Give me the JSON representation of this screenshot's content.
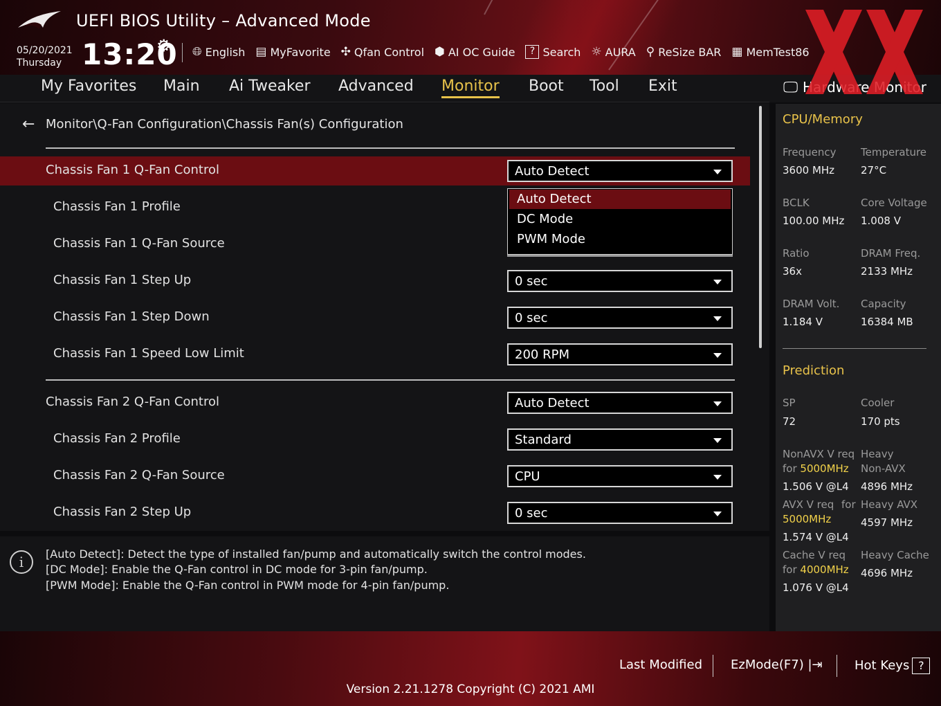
{
  "header": {
    "title": "UEFI BIOS Utility – Advanced Mode",
    "date": "05/20/2021",
    "day": "Thursday",
    "time": "13:20",
    "toolbar": [
      {
        "label": "English",
        "icon": "globe-icon"
      },
      {
        "label": "MyFavorite",
        "icon": "favorite-list-icon"
      },
      {
        "label": "Qfan Control",
        "icon": "fan-icon"
      },
      {
        "label": "AI OC Guide",
        "icon": "ai-chip-icon"
      },
      {
        "label": "Search",
        "icon": "search-help-icon"
      },
      {
        "label": "AURA",
        "icon": "aura-light-icon"
      },
      {
        "label": "ReSize BAR",
        "icon": "resize-bar-icon"
      },
      {
        "label": "MemTest86",
        "icon": "memory-icon"
      }
    ]
  },
  "menu": {
    "items": [
      "My Favorites",
      "Main",
      "Ai Tweaker",
      "Advanced",
      "Monitor",
      "Boot",
      "Tool",
      "Exit"
    ],
    "active": "Monitor"
  },
  "breadcrumb": "Monitor\\Q-Fan Configuration\\Chassis Fan(s) Configuration",
  "settings": [
    {
      "label": "Chassis Fan 1 Q-Fan Control",
      "value": "Auto Detect"
    },
    {
      "label": "Chassis Fan 1 Profile",
      "value": ""
    },
    {
      "label": "Chassis Fan 1 Q-Fan Source",
      "value": ""
    },
    {
      "label": "Chassis Fan 1 Step Up",
      "value": "0 sec"
    },
    {
      "label": "Chassis Fan 1 Step Down",
      "value": "0 sec"
    },
    {
      "label": "Chassis Fan 1 Speed Low Limit",
      "value": "200 RPM"
    },
    {
      "label": "Chassis Fan 2 Q-Fan Control",
      "value": "Auto Detect"
    },
    {
      "label": "Chassis Fan 2 Profile",
      "value": "Standard"
    },
    {
      "label": "Chassis Fan 2 Q-Fan Source",
      "value": "CPU"
    },
    {
      "label": "Chassis Fan 2 Step Up",
      "value": "0 sec"
    }
  ],
  "dropdown": {
    "options": [
      "Auto Detect",
      "DC Mode",
      "PWM Mode"
    ],
    "selected": "Auto Detect"
  },
  "help": {
    "lines": [
      "[Auto Detect]: Detect the type of installed fan/pump and automatically switch the control modes.",
      "[DC Mode]: Enable the Q-Fan control in DC mode for 3-pin fan/pump.",
      "[PWM Mode]: Enable the Q-Fan control in PWM mode for 4-pin fan/pump."
    ]
  },
  "hardware_monitor": {
    "title": "Hardware Monitor",
    "cpu_memory": {
      "title": "CPU/Memory",
      "frequency_label": "Frequency",
      "frequency": "3600 MHz",
      "temperature_label": "Temperature",
      "temperature": "27°C",
      "bclk_label": "BCLK",
      "bclk": "100.00 MHz",
      "core_voltage_label": "Core Voltage",
      "core_voltage": "1.008 V",
      "ratio_label": "Ratio",
      "ratio": "36x",
      "dram_freq_label": "DRAM Freq.",
      "dram_freq": "2133 MHz",
      "dram_volt_label": "DRAM Volt.",
      "dram_volt": "1.184 V",
      "capacity_label": "Capacity",
      "capacity": "16384 MB"
    },
    "prediction": {
      "title": "Prediction",
      "sp_label": "SP",
      "sp": "72",
      "cooler_label": "Cooler",
      "cooler": "170 pts",
      "nonavx_req_label": "NonAVX V req",
      "nonavx_for": "for",
      "nonavx_freq": "5000MHz",
      "nonavx_volt": "1.506 V @L4",
      "heavy_nonavx_label1": "Heavy",
      "heavy_nonavx_label2": "Non-AVX",
      "heavy_nonavx": "4896 MHz",
      "avx_req_label": "AVX V req",
      "avx_for": "for",
      "avx_freq": "5000MHz",
      "avx_volt": "1.574 V @L4",
      "heavy_avx_label": "Heavy AVX",
      "heavy_avx": "4597 MHz",
      "cache_req_label": "Cache V req",
      "cache_for": "for",
      "cache_freq": "4000MHz",
      "cache_volt": "1.076 V @L4",
      "heavy_cache_label": "Heavy Cache",
      "heavy_cache": "4696 MHz"
    }
  },
  "footer": {
    "last_modified": "Last Modified",
    "ezmode": "EzMode(F7)",
    "hotkeys": "Hot Keys",
    "hotkeys_key": "?",
    "version": "Version 2.21.1278 Copyright (C) 2021 AMI"
  },
  "colors": {
    "accent_gold": "#e8c24a",
    "highlight_red": "#6b0d12",
    "panel_bg": "#141416"
  }
}
